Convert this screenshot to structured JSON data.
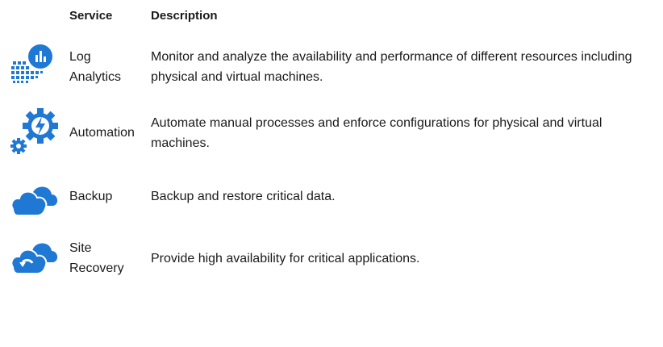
{
  "header": {
    "service": "Service",
    "description": "Description"
  },
  "rows": [
    {
      "icon": "log-analytics-icon",
      "service_line1": "Log",
      "service_line2": "Analytics",
      "description": "Monitor and analyze the availability and performance of different resources including physical and virtual machines."
    },
    {
      "icon": "automation-icon",
      "service_line1": "Automation",
      "description": "Automate manual processes and enforce configurations for physical and virtual machines."
    },
    {
      "icon": "backup-icon",
      "service_line1": "Backup",
      "description": "Backup and restore critical data."
    },
    {
      "icon": "site-recovery-icon",
      "service_line1": "Site",
      "service_line2": "Recovery",
      "description": "Provide high availability for critical applications."
    }
  ],
  "colors": {
    "icon_primary": "#1e78d4",
    "icon_dark": "#1565c0",
    "text": "#1a1a1a"
  }
}
